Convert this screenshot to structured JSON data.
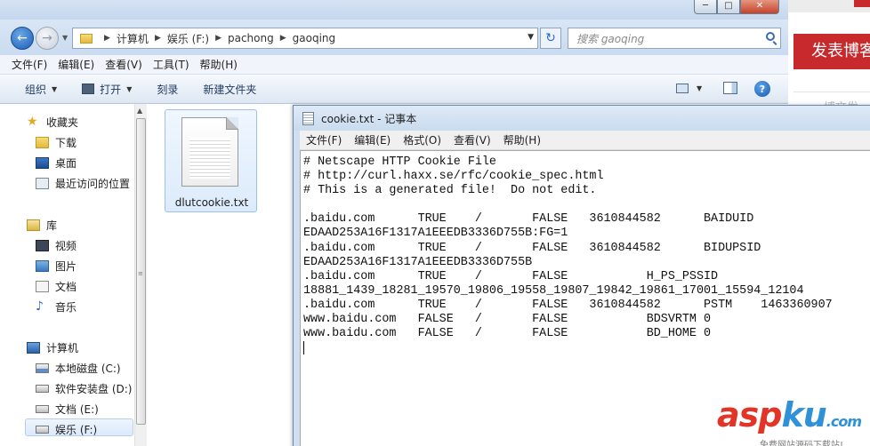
{
  "background_page": {
    "publish_button": "发表博客",
    "partial_text": "博文发"
  },
  "explorer": {
    "address": {
      "crumbs": [
        "计算机",
        "娱乐 (F:)",
        "pachong",
        "gaoqing"
      ]
    },
    "search": {
      "placeholder": "搜索 gaoqing"
    },
    "menu": [
      "文件(F)",
      "编辑(E)",
      "查看(V)",
      "工具(T)",
      "帮助(H)"
    ],
    "toolbar": {
      "organize": "组织",
      "open": "打开",
      "burn": "刻录",
      "new_folder": "新建文件夹"
    },
    "nav": {
      "favorites": "收藏夹",
      "downloads": "下载",
      "desktop": "桌面",
      "recent": "最近访问的位置",
      "libraries": "库",
      "videos": "视频",
      "pictures": "图片",
      "documents": "文档",
      "music": "音乐",
      "computer": "计算机",
      "drive_c": "本地磁盘 (C:)",
      "drive_d": "软件安装盘 (D:)",
      "drive_e": "文档 (E:)",
      "drive_f": "娱乐 (F:)"
    },
    "files": [
      {
        "name": "dlutcookie.txt",
        "icon": "text-file-icon"
      }
    ]
  },
  "notepad": {
    "title": "cookie.txt - 记事本",
    "menu": [
      "文件(F)",
      "编辑(E)",
      "格式(O)",
      "查看(V)",
      "帮助(H)"
    ],
    "lines": [
      "# Netscape HTTP Cookie File",
      "# http://curl.haxx.se/rfc/cookie_spec.html",
      "# This is a generated file!  Do not edit.",
      "",
      ".baidu.com      TRUE    /       FALSE   3610844582      BAIDUID",
      "EDAAD253A16F1317A1EEEDB3336D755B:FG=1",
      ".baidu.com      TRUE    /       FALSE   3610844582      BIDUPSID",
      "EDAAD253A16F1317A1EEEDB3336D755B",
      ".baidu.com      TRUE    /       FALSE           H_PS_PSSID",
      "18881_1439_18281_19570_19806_19558_19807_19842_19861_17001_15594_12104",
      ".baidu.com      TRUE    /       FALSE   3610844582      PSTM    1463360907",
      "www.baidu.com   FALSE   /       FALSE           BDSVRTM 0",
      "www.baidu.com   FALSE   /       FALSE           BD_HOME 0"
    ]
  },
  "watermark": {
    "asp": "asp",
    "ku": "ku",
    "dot": ".",
    "com": "com",
    "sub": "免费网站源码下载站!"
  }
}
